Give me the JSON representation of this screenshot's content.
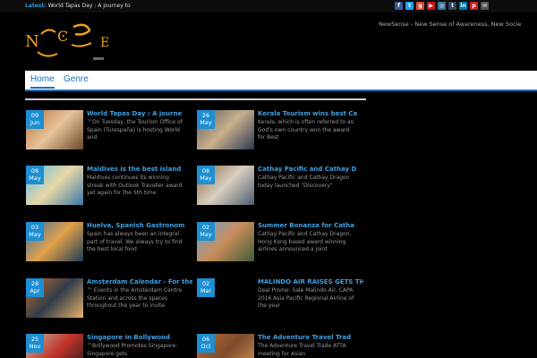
{
  "topbar": {
    "latest_label": "Latest:",
    "latest_text": "World Tapas Day : A journey to",
    "social": [
      {
        "name": "facebook-icon",
        "color": "#3b5998",
        "glyph": "f"
      },
      {
        "name": "twitter-icon",
        "color": "#1da1f2",
        "glyph": "t"
      },
      {
        "name": "google-plus-icon",
        "color": "#dd4b39",
        "glyph": "g"
      },
      {
        "name": "youtube-icon",
        "color": "#cc181e",
        "glyph": "▶"
      },
      {
        "name": "instagram-icon",
        "color": "#3f729b",
        "glyph": "◎"
      },
      {
        "name": "tumblr-icon",
        "color": "#35465c",
        "glyph": "t"
      },
      {
        "name": "linkedin-icon",
        "color": "#0077b5",
        "glyph": "in"
      },
      {
        "name": "pinterest-icon",
        "color": "#cb2027",
        "glyph": "p"
      },
      {
        "name": "email-icon",
        "color": "#555555",
        "glyph": "✉"
      }
    ]
  },
  "header": {
    "tagline": "NewSense - New Sense of Awareness, New Socie"
  },
  "nav": {
    "home": "Home",
    "genre": "Genre"
  },
  "posts": [
    {
      "day": "09",
      "month": "Jun",
      "title": "World Tapas Day : A journe",
      "excerpt": "™On Tuesday, the Tourism Office of Spain (Turespaña) is hosting World and",
      "colors": [
        "#b9713c",
        "#e6c49a",
        "#6b4a2b"
      ]
    },
    {
      "day": "26",
      "month": "May",
      "title": "Kerala Tourism wins best Ca",
      "excerpt": "Kerala, which is often referred to as God's own country won the award for Best",
      "colors": [
        "#5b5f6a",
        "#c9b08a",
        "#2e3a55"
      ]
    },
    {
      "day": "08",
      "month": "May",
      "title": "Maldives is the best island",
      "excerpt": "Maldives continues its winning streak with Outlook Traveller award yet again for the 5th time",
      "colors": [
        "#5bb8e4",
        "#e8d8a6",
        "#3a78a8"
      ]
    },
    {
      "day": "08",
      "month": "May",
      "title": "Cathay Pacific and Cathay D",
      "excerpt": "Cathay Pacific and Cathay Dragon today launched \"Discovery\"",
      "colors": [
        "#8c6a45",
        "#d8cfc0",
        "#4c5d6e"
      ]
    },
    {
      "day": "03",
      "month": "May",
      "title": "Huelva, Spanish Gastronom",
      "excerpt": "Spain has always been an integral part of travel. We always try to find the best local food",
      "colors": [
        "#3b6ea0",
        "#e2a24a",
        "#1e3a5a"
      ]
    },
    {
      "day": "02",
      "month": "May",
      "title": "Summer Bonanza for Catha",
      "excerpt": "Cathay Pacific and Cathay Dragon, Hong Kong based award winning airlines announced a joint",
      "colors": [
        "#6fa1cf",
        "#c98d5a",
        "#3d5a38"
      ]
    },
    {
      "day": "28",
      "month": "Apr",
      "title": "Amsterdam Calendar - For the",
      "excerpt": "™ Events in the Amsterdam Centre Station and across the spaces throughout the year to invite",
      "colors": [
        "#c36b2b",
        "#2f3c4a",
        "#e8b06a"
      ]
    },
    {
      "day": "02",
      "month": "Mar",
      "title": "MALINDO AIR RAISES GETS THE DEA",
      "excerpt": "Deal Promo: Sale Malindo Air, CAPA 2016 Asia Pacific Regional Airline of the year",
      "colors": [
        "#000000",
        "#000000",
        "#000000"
      ]
    },
    {
      "day": "25",
      "month": "Nov",
      "title": "Singapore in Bollywood",
      "excerpt": "™Bollywood Promotes Singapore: Singapore gets",
      "colors": [
        "#c8b9a4",
        "#c2332a",
        "#1c1c1c"
      ]
    },
    {
      "day": "06",
      "month": "Oct",
      "title": "The Adventure Travel Trad",
      "excerpt": "The Adventure Travel Trade ATTA meeting for Asian",
      "colors": [
        "#b8733d",
        "#7e4a2a",
        "#d79b5d"
      ]
    }
  ]
}
